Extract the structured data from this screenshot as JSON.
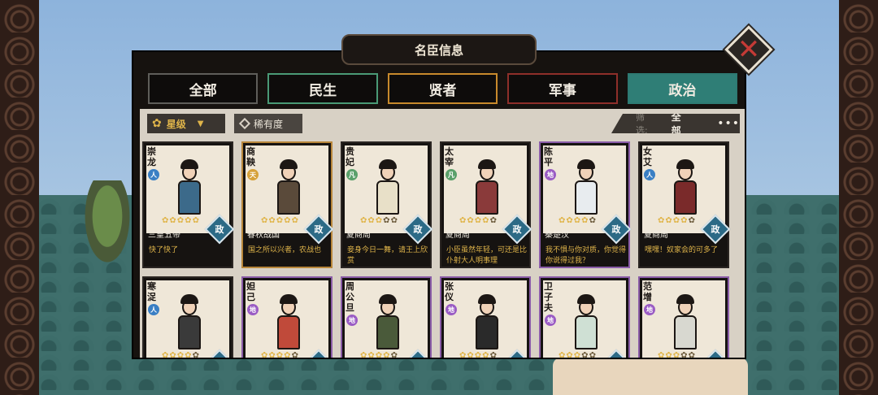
{
  "title": "名臣信息",
  "close_icon": "close-x-icon",
  "tabs": [
    {
      "label": "全部",
      "color": "#5f5e5a"
    },
    {
      "label": "民生",
      "color": "#4a9a76"
    },
    {
      "label": "贤者",
      "color": "#c88a2c"
    },
    {
      "label": "军事",
      "color": "#8e2f2a"
    },
    {
      "label": "政治",
      "color": "#2f7e76",
      "active": true
    }
  ],
  "filterbar": {
    "sort_star_label": "星级",
    "sort_rare_label": "稀有度",
    "filter_label": "筛选:",
    "filter_value": "全部",
    "more": "•••"
  },
  "badge_label": "政",
  "cards": [
    {
      "name": "崇龙",
      "tier": "人",
      "tier_class": "ren",
      "stars": 5,
      "stars_on": 5,
      "era": "三皇五帝",
      "quote": "快了快了",
      "frame": "dark"
    },
    {
      "name": "商鞅",
      "tier": "天",
      "tier_class": "tian",
      "stars": 5,
      "stars_on": 5,
      "era": "春秋战国",
      "quote": "国之所以兴者，农战也",
      "frame": "gold"
    },
    {
      "name": "贵妃",
      "tier": "凡",
      "tier_class": "fan",
      "stars": 5,
      "stars_on": 3,
      "era": "夏商周",
      "quote": "妾身今日一舞，请王上欣赏",
      "frame": "dark"
    },
    {
      "name": "太宰",
      "tier": "凡",
      "tier_class": "fan",
      "stars": 5,
      "stars_on": 4,
      "era": "夏商周",
      "quote": "小臣虽然年轻，可还是比仆射大人明事理",
      "frame": "dark"
    },
    {
      "name": "陈平",
      "tier": "地",
      "tier_class": "di",
      "stars": 5,
      "stars_on": 4,
      "era": "秦楚汉",
      "quote": "我不惧与你对质，你觉得你说得过我？",
      "frame": "purple"
    },
    {
      "name": "女艾",
      "tier": "人",
      "tier_class": "ren",
      "stars": 5,
      "stars_on": 4,
      "era": "夏商周",
      "quote": "嘿嘿！奴家会的可多了",
      "frame": "dark"
    },
    {
      "name": "寒浞",
      "tier": "人",
      "tier_class": "ren",
      "stars": 5,
      "stars_on": 4,
      "era": "",
      "quote": "",
      "frame": "dark"
    },
    {
      "name": "妲己",
      "tier": "地",
      "tier_class": "di",
      "stars": 5,
      "stars_on": 4,
      "era": "",
      "quote": "",
      "frame": "purple"
    },
    {
      "name": "周公旦",
      "tier": "地",
      "tier_class": "di",
      "stars": 5,
      "stars_on": 4,
      "era": "",
      "quote": "",
      "frame": "purple"
    },
    {
      "name": "张仪",
      "tier": "地",
      "tier_class": "di",
      "stars": 5,
      "stars_on": 4,
      "era": "",
      "quote": "",
      "frame": "purple"
    },
    {
      "name": "卫子夫",
      "tier": "地",
      "tier_class": "di",
      "stars": 5,
      "stars_on": 3,
      "era": "",
      "quote": "",
      "frame": "purple"
    },
    {
      "name": "范增",
      "tier": "地",
      "tier_class": "di",
      "stars": 5,
      "stars_on": 3,
      "era": "",
      "quote": "",
      "frame": "purple"
    }
  ],
  "figure_colors": [
    "#3c6a8a",
    "#5a4a3a",
    "#e8e0c8",
    "#8a3a3a",
    "#e8ecef",
    "#7a2a2a",
    "#3a3a3a",
    "#c04a3a",
    "#4a5a3a",
    "#2a2a2a",
    "#cfe0d4",
    "#d8d8d0"
  ]
}
